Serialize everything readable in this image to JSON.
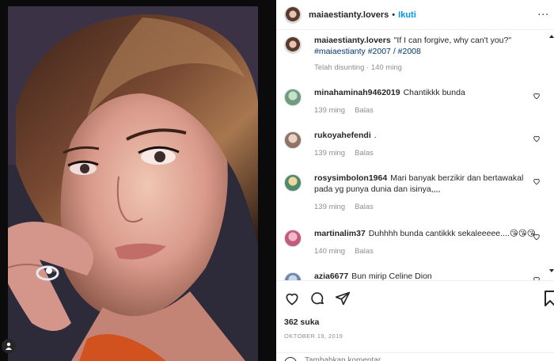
{
  "post": {
    "username": "maiaestianty.lovers",
    "separator": "•",
    "follow_label": "Ikuti",
    "more_label": "..."
  },
  "caption": {
    "username": "maiaestianty.lovers",
    "text": "\"If I can forgive, why can't you?\"",
    "tags": "#maiaestianty #2007 / #2008",
    "edited": "Telah disunting · 140 ming"
  },
  "comments": [
    {
      "username": "minahaminah9462019",
      "text": "Chantikkk bunda",
      "time": "139 ming",
      "reply": "Balas"
    },
    {
      "username": "rukoyahefendi",
      "text": ".",
      "time": "139 ming",
      "reply": "Balas"
    },
    {
      "username": "rosysimbolon1964",
      "text": "Mari banyak berzikir dan bertawakal pada yg punya dunia dan isinya,,,,",
      "time": "139 ming",
      "reply": "Balas"
    },
    {
      "username": "martinalim37",
      "text": "Duhhhh bunda cantikkk sekaleeeee....😘😘😘",
      "time": "140 ming",
      "reply": "Balas"
    },
    {
      "username": "azia6677",
      "text": "Bun mirip Celine Dion",
      "time": "",
      "reply": ""
    }
  ],
  "actions": {
    "likes": "362 suka",
    "date": "OKTOBER 19, 2019",
    "comment_placeholder": "Tambahkan komentar..."
  },
  "colors": {
    "link": "#0095f6",
    "hashtag": "#00376b",
    "muted": "#8e8e8e",
    "text": "#262626"
  }
}
